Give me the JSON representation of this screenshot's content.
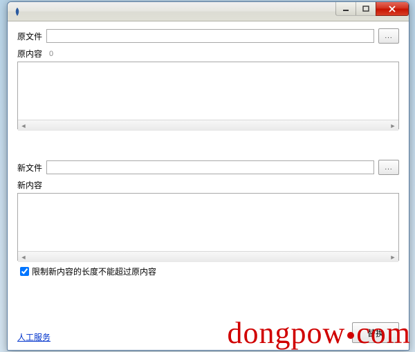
{
  "window": {
    "title": ""
  },
  "labels": {
    "orig_file": "原文件",
    "orig_content": "原内容",
    "orig_count": "0",
    "new_file": "新文件",
    "new_content": "新内容",
    "browse": "...",
    "limit_checkbox": "限制新内容的长度不能超过原内容",
    "service_link": "人工服务",
    "replace": "替换"
  },
  "values": {
    "orig_file": "",
    "orig_content": "",
    "new_file": "",
    "new_content": "",
    "limit_checked": true
  },
  "watermark": "dongpow.com"
}
